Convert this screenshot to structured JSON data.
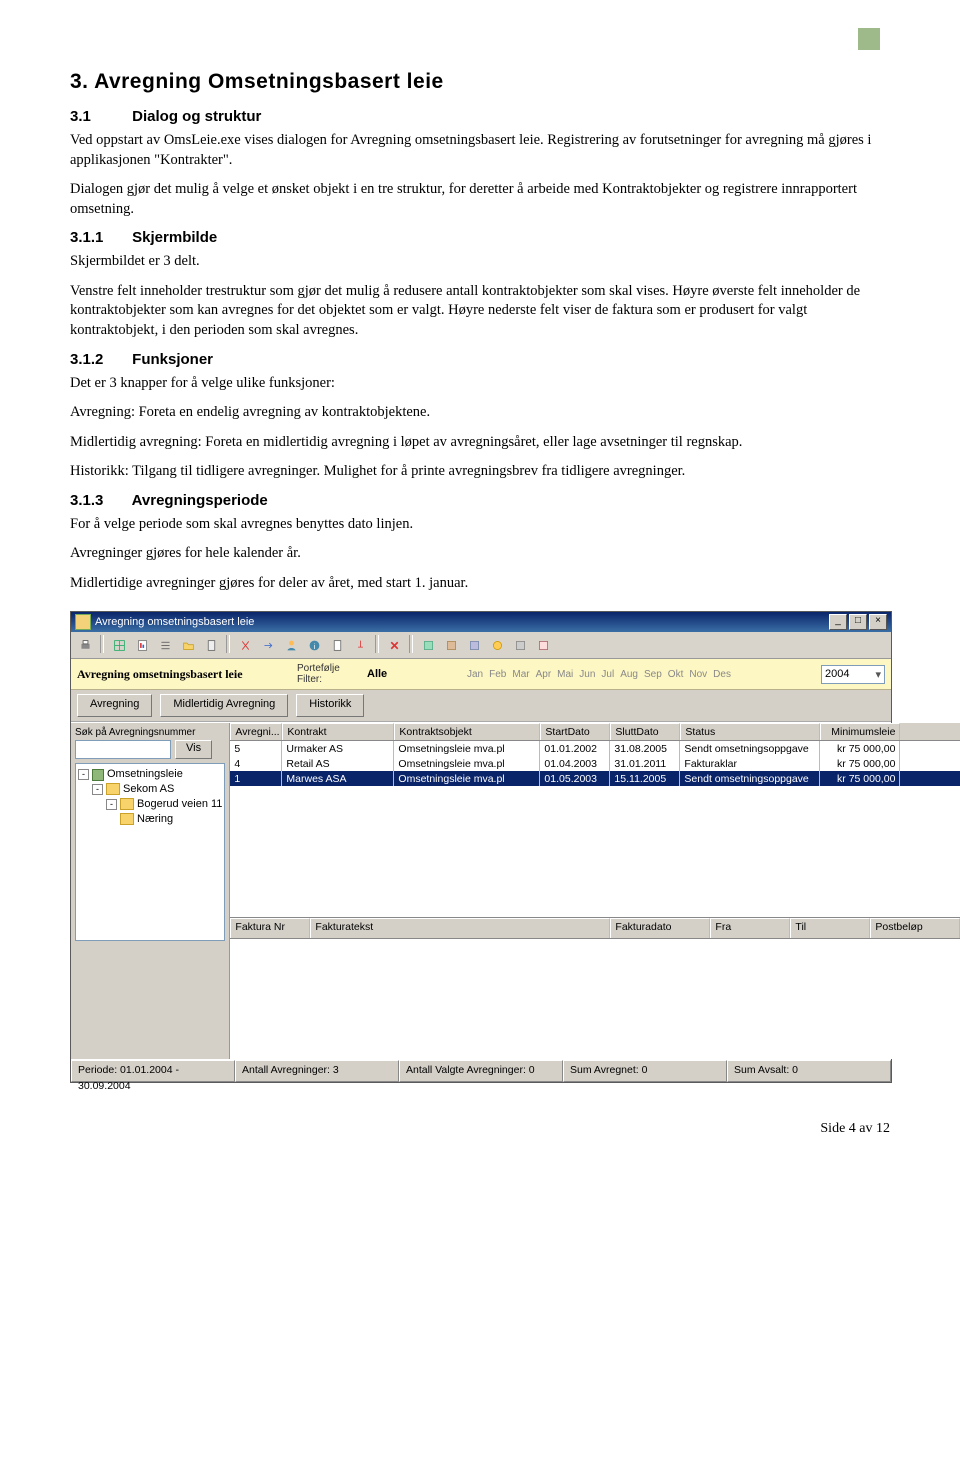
{
  "doc": {
    "h2": "3. Avregning Omsetningsbasert leie",
    "s31_num": "3.1",
    "s31_title": "Dialog og struktur",
    "p1": "Ved oppstart av OmsLeie.exe vises dialogen for Avregning omsetningsbasert leie. Registrering av forutsetninger for avregning må gjøres i applikasjonen \"Kontrakter\".",
    "p2": "Dialogen gjør det mulig å velge et ønsket objekt i en tre struktur, for deretter å arbeide med Kontraktobjekter og registrere innrapportert omsetning.",
    "s311_num": "3.1.1",
    "s311_title": "Skjermbilde",
    "p3": "Skjermbildet er 3 delt.",
    "p4": "Venstre felt inneholder trestruktur som gjør det mulig å redusere antall kontraktobjekter som skal vises. Høyre øverste felt inneholder de kontraktobjekter som kan avregnes for det objektet som er valgt. Høyre nederste felt viser de faktura som er produsert for valgt kontraktobjekt, i den perioden som skal avregnes.",
    "s312_num": "3.1.2",
    "s312_title": "Funksjoner",
    "p5": "Det er 3 knapper for å velge ulike funksjoner:",
    "p6": "Avregning: Foreta en endelig avregning av kontraktobjektene.",
    "p7": "Midlertidig avregning: Foreta en midlertidig avregning i løpet av avregningsåret, eller lage avsetninger til regnskap.",
    "p8": "Historikk: Tilgang til tidligere avregninger. Mulighet for å printe avregningsbrev fra tidligere avregninger.",
    "s313_num": "3.1.3",
    "s313_title": "Avregningsperiode",
    "p9": "For å velge periode som skal avregnes benyttes dato linjen.",
    "p10": "Avregninger gjøres for hele kalender år.",
    "p11": "Midlertidige avregninger gjøres for deler av året, med start 1. januar.",
    "footer": "Side 4 av 12"
  },
  "win": {
    "title": "Avregning omsetningsbasert leie",
    "yellow_title": "Avregning omsetningsbasert leie",
    "pf_label1": "Portefølje",
    "pf_label2": "Filter:",
    "pf_value": "Alle",
    "months": [
      "Jan",
      "Feb",
      "Mar",
      "Apr",
      "Mai",
      "Jun",
      "Jul",
      "Aug",
      "Sep",
      "Okt",
      "Nov",
      "Des"
    ],
    "year": "2004",
    "btn_avregning": "Avregning",
    "btn_midlertidig": "Midlertidig Avregning",
    "btn_historikk": "Historikk",
    "search_label": "Søk på Avregningsnummer",
    "btn_vis": "Vis",
    "tree": {
      "root": "Omsetningsleie",
      "n1": "Sekom AS",
      "n2": "Bogerud veien 11",
      "n3": "Næring"
    },
    "grid": {
      "headers": {
        "av": "Avregni...",
        "ko": "Kontrakt",
        "kob": "Kontraktsobjekt",
        "sd": "StartDato",
        "ed": "SluttDato",
        "st": "Status",
        "ml": "Minimumsleie"
      },
      "rows": [
        {
          "av": "5",
          "ko": "Urmaker AS",
          "kob": "Omsetningsleie mva.pl",
          "sd": "01.01.2002",
          "ed": "31.08.2005",
          "st": "Sendt omsetningsoppgave",
          "ml": "kr 75 000,00"
        },
        {
          "av": "4",
          "ko": "Retail AS",
          "kob": "Omsetningsleie mva.pl",
          "sd": "01.04.2003",
          "ed": "31.01.2011",
          "st": "Fakturaklar",
          "ml": "kr 75 000,00"
        },
        {
          "av": "1",
          "ko": "Marwes ASA",
          "kob": "Omsetningsleie mva.pl",
          "sd": "01.05.2003",
          "ed": "15.11.2005",
          "st": "Sendt omsetningsoppgave",
          "ml": "kr 75 000,00"
        }
      ]
    },
    "lowgrid": {
      "nr": "Faktura Nr",
      "tx": "Fakturatekst",
      "fd": "Fakturadato",
      "fr": "Fra",
      "ti": "Til",
      "pb": "Postbeløp"
    },
    "status": {
      "periode": "Periode: 01.01.2004 - 30.09.2004",
      "antall": "Antall Avregninger: 3",
      "valgte": "Antall Valgte Avregninger: 0",
      "sumav": "Sum Avregnet: 0",
      "sumavs": "Sum Avsalt: 0"
    }
  }
}
